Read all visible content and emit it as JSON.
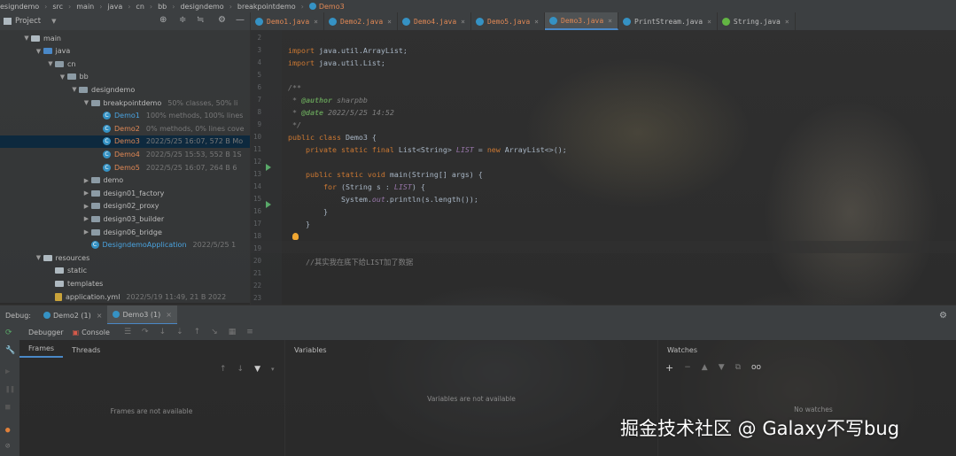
{
  "breadcrumb": [
    "esigndemo",
    "src",
    "main",
    "java",
    "cn",
    "bb",
    "designdemo",
    "breakpointdemo",
    "Demo3"
  ],
  "project_panel": {
    "title": "Project",
    "tree": [
      {
        "label": "main",
        "kind": "folder",
        "depth": 2,
        "expanded": true
      },
      {
        "label": "java",
        "kind": "folder-blue",
        "depth": 3,
        "expanded": true
      },
      {
        "label": "cn",
        "kind": "pkg",
        "depth": 4,
        "expanded": true
      },
      {
        "label": "bb",
        "kind": "pkg",
        "depth": 5,
        "expanded": true
      },
      {
        "label": "designdemo",
        "kind": "pkg",
        "depth": 6,
        "expanded": true
      },
      {
        "label": "breakpointdemo",
        "kind": "pkg",
        "depth": 7,
        "expanded": true,
        "meta": "50% classes, 50% li"
      },
      {
        "label": "Demo1",
        "kind": "class",
        "depth": 8,
        "meta": "100% methods, 100% lines",
        "color": "blue"
      },
      {
        "label": "Demo2",
        "kind": "class",
        "depth": 8,
        "meta": "0% methods, 0% lines cove",
        "color": "orange"
      },
      {
        "label": "Demo3",
        "kind": "class",
        "depth": 8,
        "meta": "2022/5/25 16:07, 572 B Mo",
        "color": "orange",
        "selected": true
      },
      {
        "label": "Demo4",
        "kind": "class",
        "depth": 8,
        "meta": "2022/5/25 15:53, 552 B 1S",
        "color": "orange"
      },
      {
        "label": "Demo5",
        "kind": "class",
        "depth": 8,
        "meta": "2022/5/25 16:07, 264 B 6",
        "color": "orange"
      },
      {
        "label": "demo",
        "kind": "pkg",
        "depth": 7,
        "expanded": false
      },
      {
        "label": "design01_factory",
        "kind": "pkg",
        "depth": 7,
        "expanded": false
      },
      {
        "label": "design02_proxy",
        "kind": "pkg",
        "depth": 7,
        "expanded": false
      },
      {
        "label": "design03_builder",
        "kind": "pkg",
        "depth": 7,
        "expanded": false
      },
      {
        "label": "design06_bridge",
        "kind": "pkg",
        "depth": 7,
        "expanded": false
      },
      {
        "label": "DesigndemoApplication",
        "kind": "class",
        "depth": 7,
        "meta": "2022/5/25 1",
        "color": "blue"
      },
      {
        "label": "resources",
        "kind": "folder",
        "depth": 3,
        "expanded": true
      },
      {
        "label": "static",
        "kind": "folder",
        "depth": 4
      },
      {
        "label": "templates",
        "kind": "folder",
        "depth": 4
      },
      {
        "label": "application.yml",
        "kind": "file",
        "depth": 4,
        "meta": "2022/5/19 11:49, 21 B 2022"
      }
    ]
  },
  "editor": {
    "tabs": [
      {
        "label": "Demo1.java",
        "active": false
      },
      {
        "label": "Demo2.java",
        "active": false
      },
      {
        "label": "Demo4.java",
        "active": false
      },
      {
        "label": "Demo5.java",
        "active": false
      },
      {
        "label": "Demo3.java",
        "active": true
      },
      {
        "label": "PrintStream.java",
        "active": false
      },
      {
        "label": "String.java",
        "active": false,
        "iface": true
      }
    ],
    "line_numbers": [
      "2",
      "3",
      "4",
      "5",
      "6",
      "7",
      "8",
      "9",
      "10",
      "11",
      "12",
      "13",
      "14",
      "15",
      "16",
      "17",
      "18",
      "19",
      "20",
      "21",
      "22",
      "23"
    ],
    "code": {
      "l3": "import java.util.ArrayList;",
      "l4": "import java.util.List;",
      "l6": "/**",
      "l7_tag": "@author",
      "l7_val": " sharpbb",
      "l8_tag": "@date",
      "l8_val": " 2022/5/25 14:52",
      "l9": " */",
      "l10": "public class Demo3 {",
      "l11_a": "    private static final ",
      "l11_b": "List<String> ",
      "l11_c": "LIST",
      "l11_d": " = ",
      "l11_e": "new",
      "l11_f": " ArrayList<>();",
      "l13_a": "    public static void ",
      "l13_b": "main(String[] args) {",
      "l14_a": "        for ",
      "l14_b": "(String s : ",
      "l14_c": "LIST",
      "l14_d": ") {",
      "l15_a": "            System.",
      "l15_b": "out",
      "l15_c": ".println(s.length());",
      "l16": "        }",
      "l17": "    }",
      "l20": "    //其实我在底下给LIST加了数据"
    }
  },
  "debug": {
    "label": "Debug:",
    "sessions": [
      {
        "label": "Demo2 (1)",
        "active": false
      },
      {
        "label": "Demo3 (1)",
        "active": true
      }
    ],
    "tabs": [
      "Debugger",
      "Console"
    ],
    "frames_tabs": [
      "Frames",
      "Threads"
    ],
    "frames_empty": "Frames are not available",
    "variables_title": "Variables",
    "variables_empty": "Variables are not available",
    "watches_title": "Watches",
    "watches_empty": "No watches"
  },
  "watermark": "掘金技术社区 @ Galaxy不写bug",
  "colors": {
    "accent": "#4a88c7",
    "keyword": "#cc7832",
    "selection": "#0d293e"
  }
}
